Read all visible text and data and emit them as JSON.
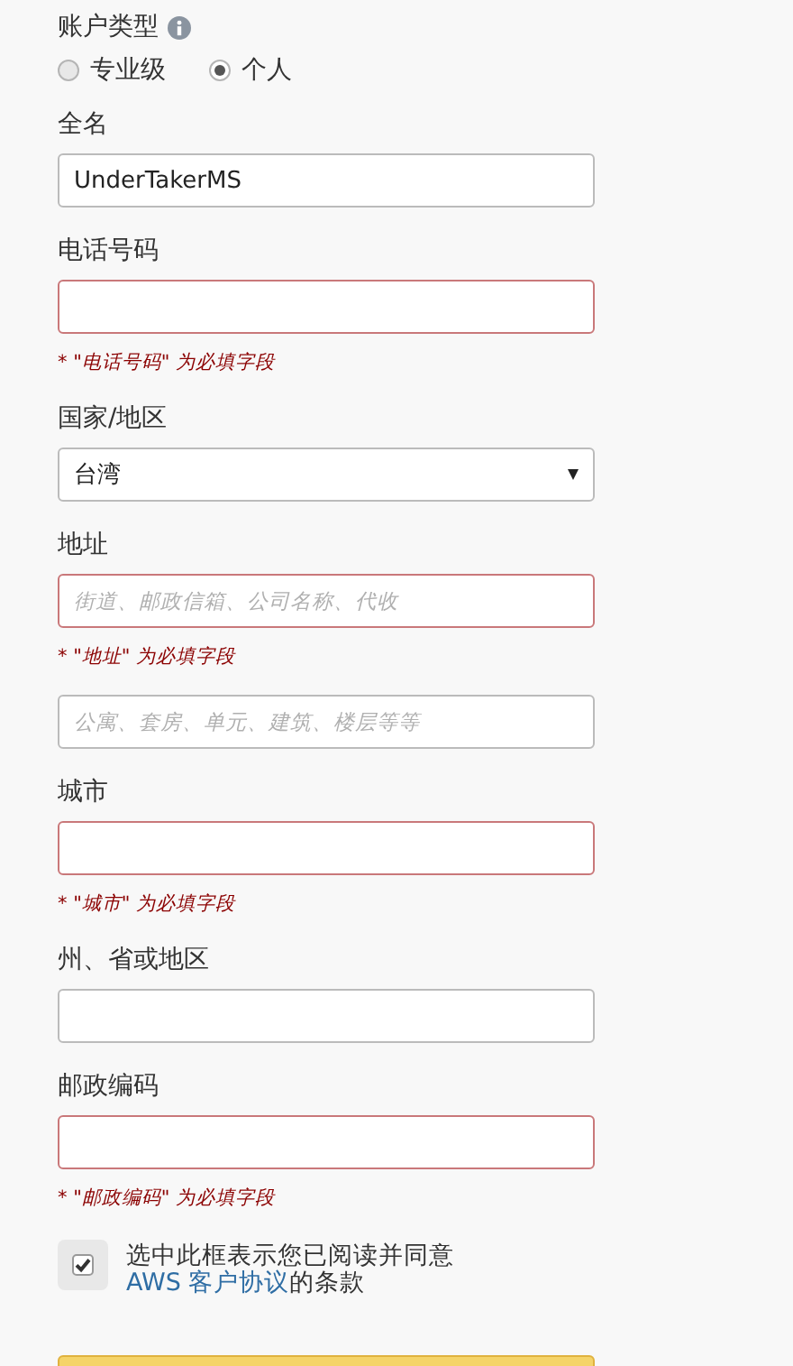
{
  "account_type": {
    "label": "账户类型",
    "options": [
      {
        "label": "专业级",
        "selected": false
      },
      {
        "label": "个人",
        "selected": true
      }
    ]
  },
  "items": [
    {
      "kind": "label",
      "text": "全名"
    },
    {
      "kind": "input",
      "value": "UnderTakerMS",
      "invalid": false
    },
    {
      "kind": "label",
      "text": "电话号码"
    },
    {
      "kind": "input",
      "invalid": true
    },
    {
      "kind": "error",
      "text": "* \"电话号码\" 为必填字段"
    },
    {
      "kind": "label",
      "text": "国家/地区"
    },
    {
      "kind": "select",
      "value": "台湾"
    },
    {
      "kind": "label",
      "text": "地址"
    },
    {
      "kind": "input",
      "placeholder": "街道、邮政信箱、公司名称、代收",
      "invalid": true
    },
    {
      "kind": "error",
      "text": "* \"地址\" 为必填字段"
    },
    {
      "kind": "input",
      "placeholder": "公寓、套房、单元、建筑、楼层等等",
      "invalid": false
    },
    {
      "kind": "label",
      "text": "城市"
    },
    {
      "kind": "input",
      "invalid": true
    },
    {
      "kind": "error",
      "text": "* \"城市\" 为必填字段"
    },
    {
      "kind": "label",
      "text": "州、省或地区"
    },
    {
      "kind": "input",
      "invalid": false
    },
    {
      "kind": "label",
      "text": "邮政编码"
    },
    {
      "kind": "input",
      "invalid": true
    },
    {
      "kind": "error",
      "text": "* \"邮政编码\" 为必填字段"
    }
  ],
  "agreement": {
    "checked": true,
    "before": "选中此框表示您已阅读并同意",
    "link": "AWS 客户协议",
    "after": "的条款"
  }
}
